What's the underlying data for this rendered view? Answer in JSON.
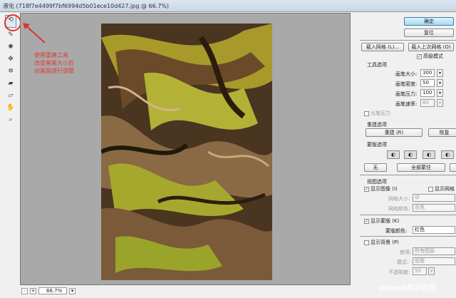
{
  "window": {
    "title": "液化 (718f7e4499f7bf6994d5b01ece10d427.jpg @ 66.7%)"
  },
  "annotation": [
    "使用重建工具",
    "改变画笔大小后",
    "对画面进行调整"
  ],
  "tools": [
    "reconstruct-tool",
    "forward-warp-tool",
    "twirl-tool",
    "pucker-tool",
    "bloat-tool",
    "freeze-mask-tool",
    "thaw-mask-tool",
    "hand-tool",
    "zoom-tool"
  ],
  "status": {
    "zoom": "66.7%",
    "minus": "-",
    "plus": "+"
  },
  "panel": {
    "ok": "确定",
    "reset": "复位",
    "load_mesh": "载入网格 (L)...",
    "load_last_mesh": "载入上次网格 (O)",
    "advanced_mode": "高级模式",
    "tool_options": "工具选项",
    "brush_size_label": "画笔大小:",
    "brush_size": "300",
    "brush_density_label": "画笔密度:",
    "brush_density": "50",
    "brush_pressure_label": "画笔压力:",
    "brush_pressure": "100",
    "brush_rate_label": "画笔速率:",
    "brush_rate": "80",
    "stylus_pressure": "光笔压力",
    "reconstruct_options": "重建选项",
    "reconstruct": "重建 (R)",
    "restore_all": "恢复",
    "mask_options": "蒙版选项",
    "none": "无",
    "mask_all": "全部蒙住",
    "view_options": "视图选项",
    "show_image": "显示图像 (I)",
    "show_mesh": "显示网格",
    "mesh_size_label": "网格大小:",
    "mesh_size": "中",
    "mesh_color_label": "网格颜色:",
    "mesh_color": "灰色",
    "show_mask": "显示蒙版 (K)",
    "mask_color_label": "蒙版颜色:",
    "mask_color": "红色",
    "show_backdrop": "显示背景 (P)",
    "use_label": "使用:",
    "use": "所有图层",
    "mode_label": "模式:",
    "mode": "前面",
    "opacity_label": "不透明度:",
    "opacity": "50"
  },
  "watermark": "@Ulook知识在线"
}
